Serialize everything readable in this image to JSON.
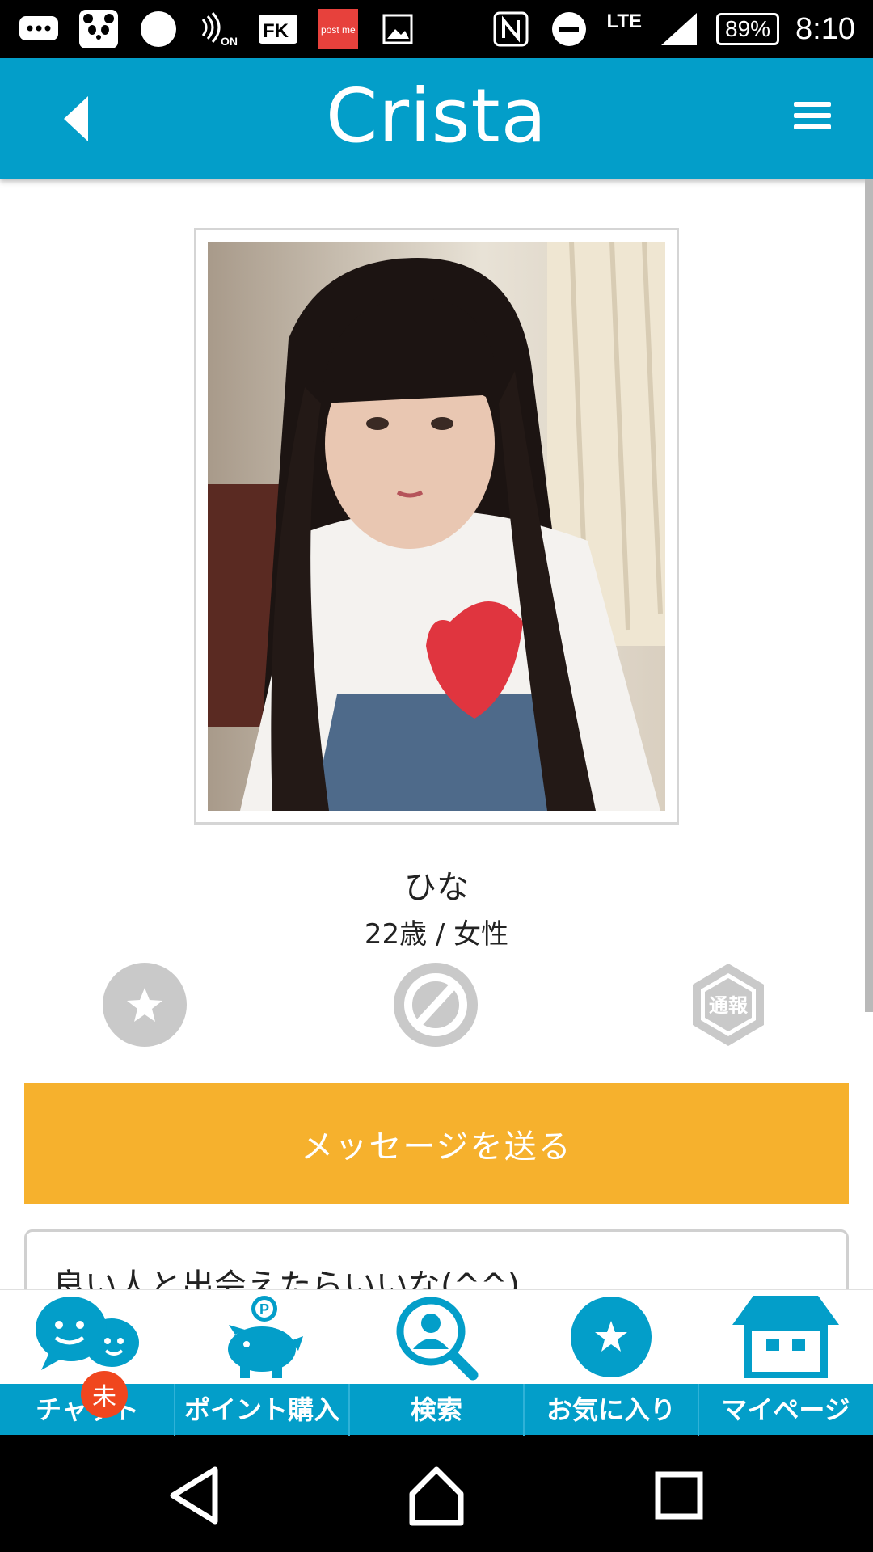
{
  "status_bar": {
    "icons": [
      "message-icon",
      "panda-app-icon",
      "circle-icon",
      "nfc-on-icon",
      "fk-app-icon",
      "postme-app-icon",
      "gallery-icon",
      "nfc-icon",
      "do-not-disturb-icon",
      "signal-icon"
    ],
    "network": "LTE",
    "battery": "89%",
    "time": "8:10"
  },
  "header": {
    "title": "Crista",
    "back_icon": "back-arrow-icon",
    "menu_icon": "hamburger-menu-icon",
    "color": "#039ec9"
  },
  "profile": {
    "name": "ひな",
    "age_gender": "22歳 / 女性",
    "actions": [
      {
        "name": "favorite",
        "icon": "star-icon"
      },
      {
        "name": "block",
        "icon": "block-icon"
      },
      {
        "name": "report",
        "icon": "report-hexagon-icon",
        "label": "通報"
      }
    ],
    "message_button": "メッセージを送る",
    "message_button_color": "#f6b12d",
    "bio": "良い人と出会えたらいいな(^^)"
  },
  "bottom_nav": {
    "items": [
      {
        "label": "チャット",
        "icon": "chat-bubbles-icon",
        "badge": "未"
      },
      {
        "label": "ポイント購入",
        "icon": "piggy-bank-icon"
      },
      {
        "label": "検索",
        "icon": "search-user-icon"
      },
      {
        "label": "お気に入り",
        "icon": "star-circle-icon"
      },
      {
        "label": "マイページ",
        "icon": "house-icon"
      }
    ]
  },
  "system_nav": [
    "back-icon",
    "home-icon",
    "recents-icon"
  ]
}
